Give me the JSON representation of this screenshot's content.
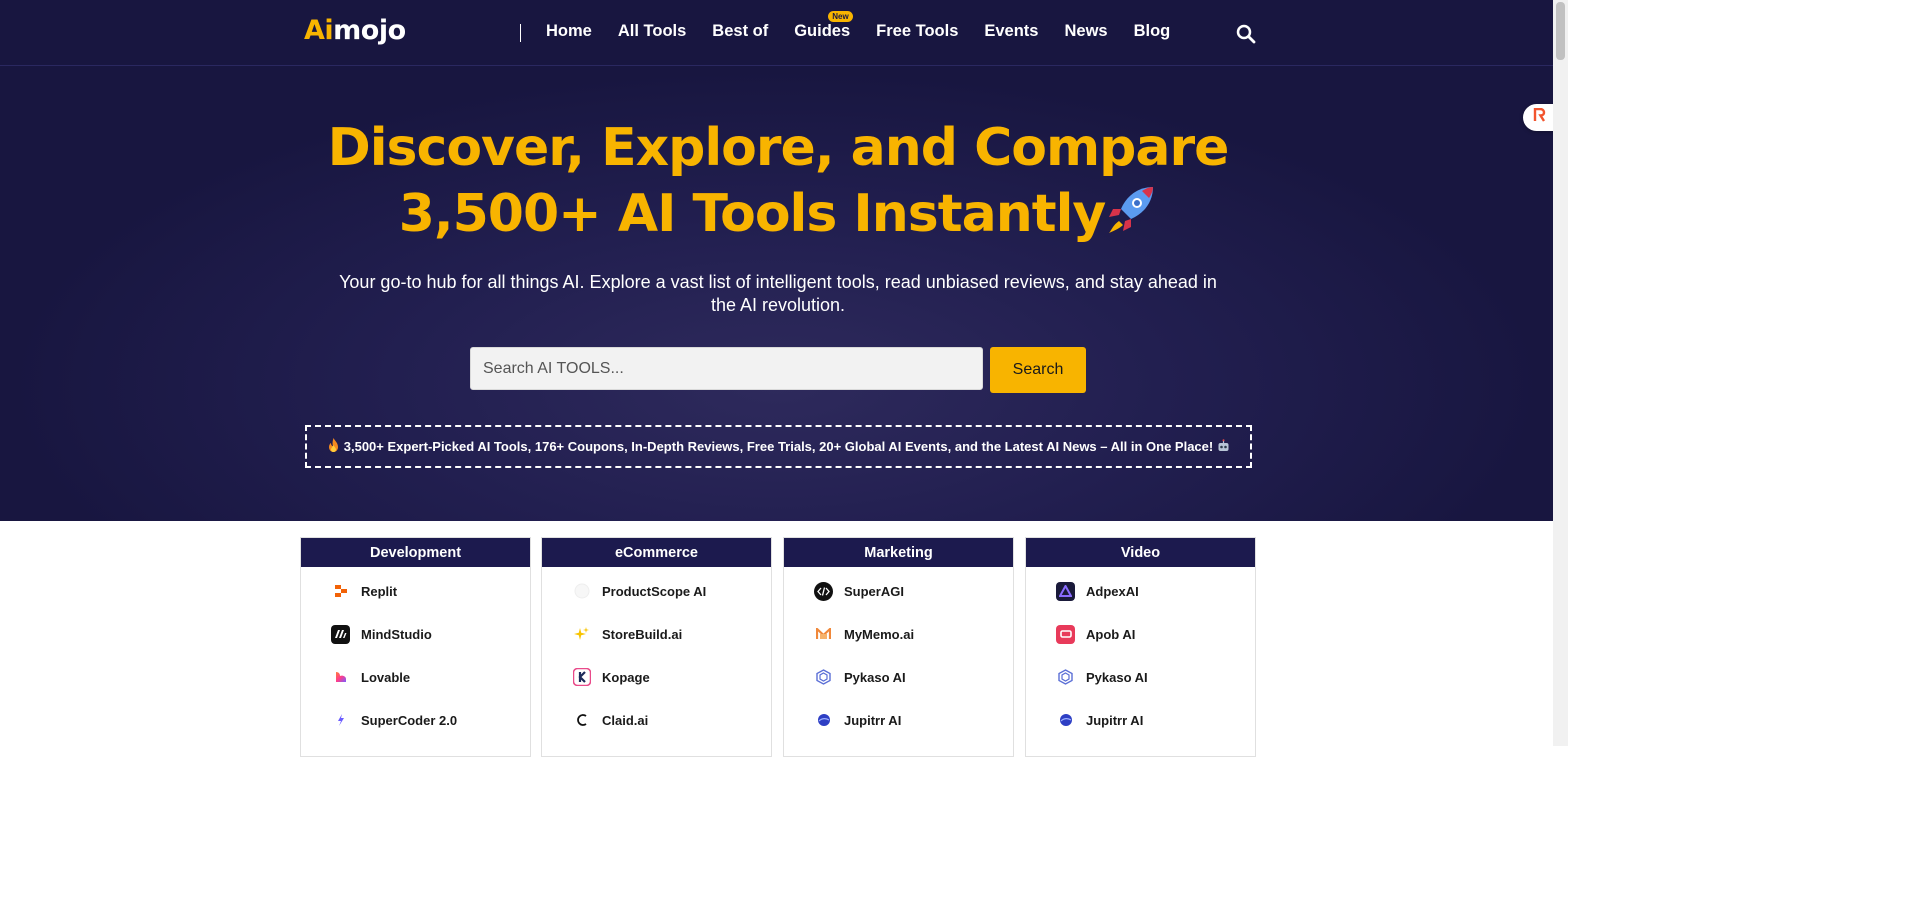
{
  "header": {
    "logo_ai": "Ai",
    "logo_mojo": "mojo",
    "nav": [
      "Home",
      "All Tools",
      "Best of",
      "Guides",
      "Free Tools",
      "Events",
      "News",
      "Blog"
    ],
    "guides_badge": "New"
  },
  "hero": {
    "title": "Discover, Explore, and Compare 3,500+ AI Tools Instantly",
    "subtitle": "Your go-to hub for all things AI. Explore a vast list of intelligent tools, read unbiased reviews, and stay ahead in the AI revolution.",
    "search_placeholder": "Search AI TOOLS...",
    "search_button": "Search",
    "banner": "3,500+ Expert-Picked AI Tools, 176+ Coupons, In-Depth Reviews, Free Trials, 20+ Global AI Events, and the Latest AI News – All in One Place!"
  },
  "categories": [
    {
      "title": "Development",
      "tools": [
        "Replit",
        "MindStudio",
        "Lovable",
        "SuperCoder 2.0"
      ]
    },
    {
      "title": "eCommerce",
      "tools": [
        "ProductScope AI",
        "StoreBuild.ai",
        "Kopage",
        "Claid.ai"
      ]
    },
    {
      "title": "Marketing",
      "tools": [
        "SuperAGI",
        "MyMemo.ai",
        "Pykaso AI",
        "Jupitrr AI"
      ]
    },
    {
      "title": "Video",
      "tools": [
        "AdpexAI",
        "Apob AI",
        "Pykaso AI",
        "Jupitrr AI"
      ]
    }
  ],
  "colors": {
    "brand_navy": "#181640",
    "accent_yellow": "#f8b400"
  }
}
